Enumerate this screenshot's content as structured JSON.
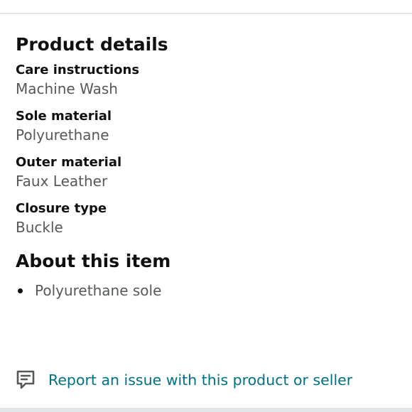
{
  "product_details": {
    "heading": "Product details",
    "items": [
      {
        "label": "Care instructions",
        "value": "Machine Wash"
      },
      {
        "label": "Sole material",
        "value": "Polyurethane"
      },
      {
        "label": "Outer material",
        "value": "Faux Leather"
      },
      {
        "label": "Closure type",
        "value": "Buckle"
      }
    ]
  },
  "about": {
    "heading": "About this item",
    "bullets": [
      "Polyurethane sole"
    ]
  },
  "report": {
    "icon": "feedback-message-icon",
    "label": "Report an issue with this product or seller"
  },
  "colors": {
    "text": "#0f1111",
    "secondary_text": "#565959",
    "link": "#007185",
    "divider": "#e3e6e6"
  }
}
